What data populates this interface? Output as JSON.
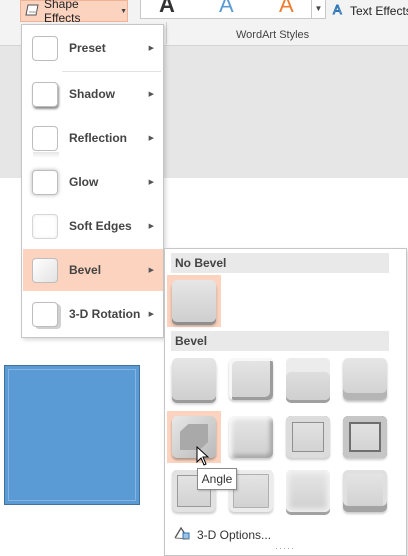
{
  "ribbon": {
    "shape_effects_label": "Shape Effects",
    "text_effects_label": "Text Effects",
    "wordart_group_label": "WordArt Styles",
    "wordart_samples": [
      "A",
      "A",
      "A"
    ]
  },
  "menu": {
    "items": [
      {
        "label": "Preset"
      },
      {
        "label": "Shadow"
      },
      {
        "label": "Reflection"
      },
      {
        "label": "Glow"
      },
      {
        "label": "Soft Edges"
      },
      {
        "label": "Bevel"
      },
      {
        "label": "3-D Rotation"
      }
    ],
    "active_item": "Bevel"
  },
  "bevel_submenu": {
    "no_bevel_header": "No Bevel",
    "bevel_header": "Bevel",
    "options_label": "3-D Options...",
    "tooltip": "Angle",
    "selected": "Angle"
  },
  "colors": {
    "accent_highlight": "#fbd3bf",
    "shape_fill": "#5b9bd5",
    "shape_border": "#41719c",
    "wordart_samples": [
      "#333333",
      "#5b9bd5",
      "#ed7d31"
    ]
  },
  "icons": [
    "shape-effects-icon",
    "text-effects-icon",
    "3d-options-icon",
    "mouse-pointer-icon"
  ]
}
